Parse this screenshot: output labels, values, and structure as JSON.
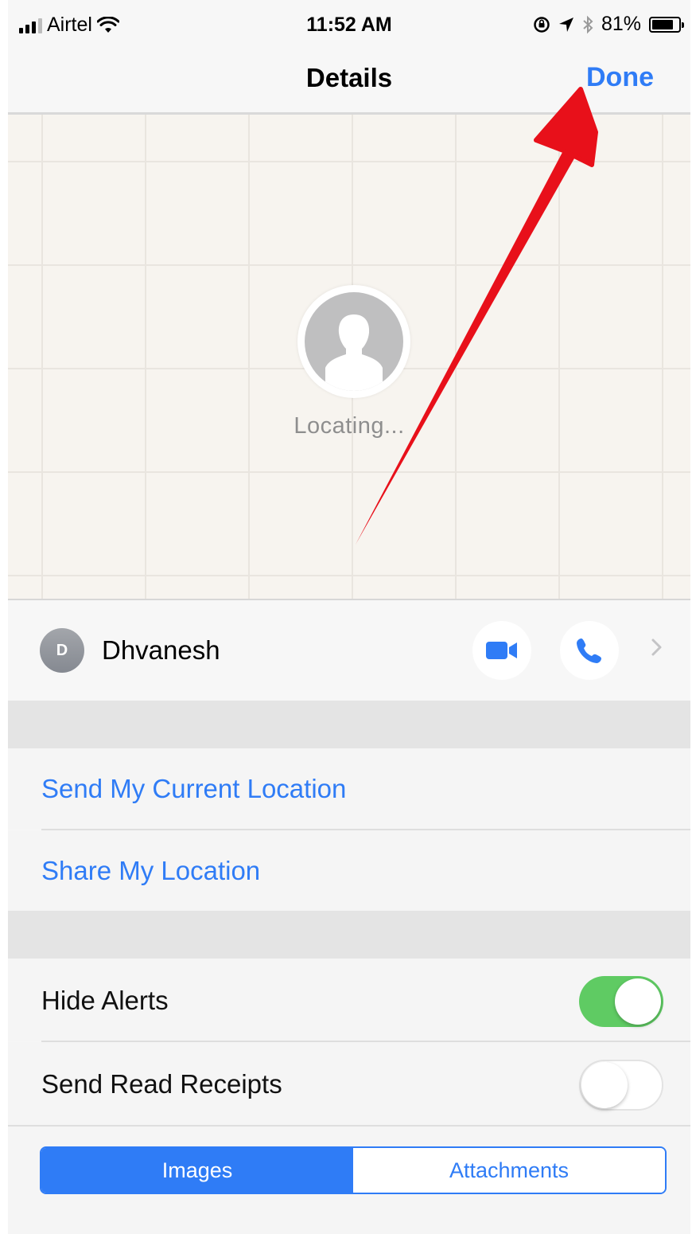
{
  "status_bar": {
    "carrier": "Airtel",
    "time": "11:52 AM",
    "battery": "81%",
    "battery_level": 0.81,
    "icons": [
      "signal-icon",
      "wifi-icon",
      "orientation-lock-icon",
      "location-arrow-icon",
      "bluetooth-icon",
      "battery-icon"
    ]
  },
  "nav": {
    "title": "Details",
    "done_label": "Done"
  },
  "map": {
    "status": "Locating..."
  },
  "contact": {
    "initial": "D",
    "name": "Dhvanesh"
  },
  "location_actions": {
    "send_current": "Send My Current Location",
    "share": "Share My Location"
  },
  "settings": {
    "hide_alerts": {
      "label": "Hide Alerts",
      "on": true
    },
    "read_receipts": {
      "label": "Send Read Receipts",
      "on": false
    }
  },
  "segments": {
    "images": "Images",
    "attachments": "Attachments",
    "selected": "Images"
  },
  "colors": {
    "accent": "#2f7cf6",
    "toggle_on": "#5fcb63",
    "annotation_arrow": "#e8101a"
  }
}
